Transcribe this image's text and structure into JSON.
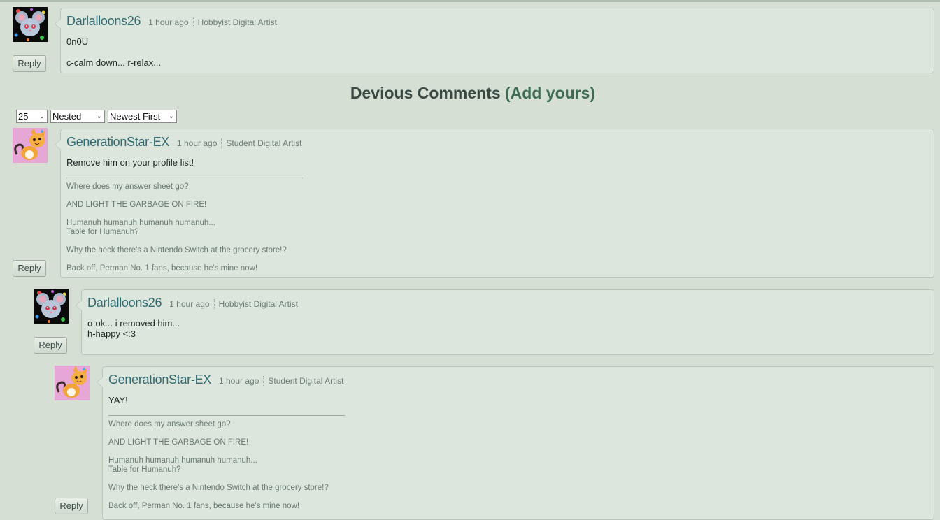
{
  "reply_label": "Reply",
  "top_comment": {
    "username": "Darlalloons26",
    "time": "1 hour ago",
    "badge": "Hobbyist Digital Artist",
    "lines": [
      "0n0U",
      "c-calm down... r-relax..."
    ]
  },
  "section": {
    "title": "Devious Comments",
    "add_link": "(Add yours)"
  },
  "controls": {
    "count": "25",
    "view": "Nested",
    "order": "Newest First"
  },
  "signature": [
    "Where does my answer sheet go?",
    "AND LIGHT THE GARBAGE ON FIRE!",
    "Humanuh humanuh humanuh humanuh...",
    "Table for Humanuh?",
    "Why the heck there's a Nintendo Switch at the grocery store!?",
    "Back off, Perman No. 1 fans, because he's mine now!"
  ],
  "comments": [
    {
      "username": "GenerationStar-EX",
      "time": "1 hour ago",
      "badge": "Student Digital Artist",
      "lines": [
        "Remove him on your profile list!"
      ]
    },
    {
      "username": "Darlalloons26",
      "time": "1 hour ago",
      "badge": "Hobbyist Digital Artist",
      "lines": [
        "o-ok... i removed him...",
        "h-happy <:3"
      ]
    },
    {
      "username": "GenerationStar-EX",
      "time": "1 hour ago",
      "badge": "Student Digital Artist",
      "lines": [
        "YAY!"
      ]
    }
  ]
}
